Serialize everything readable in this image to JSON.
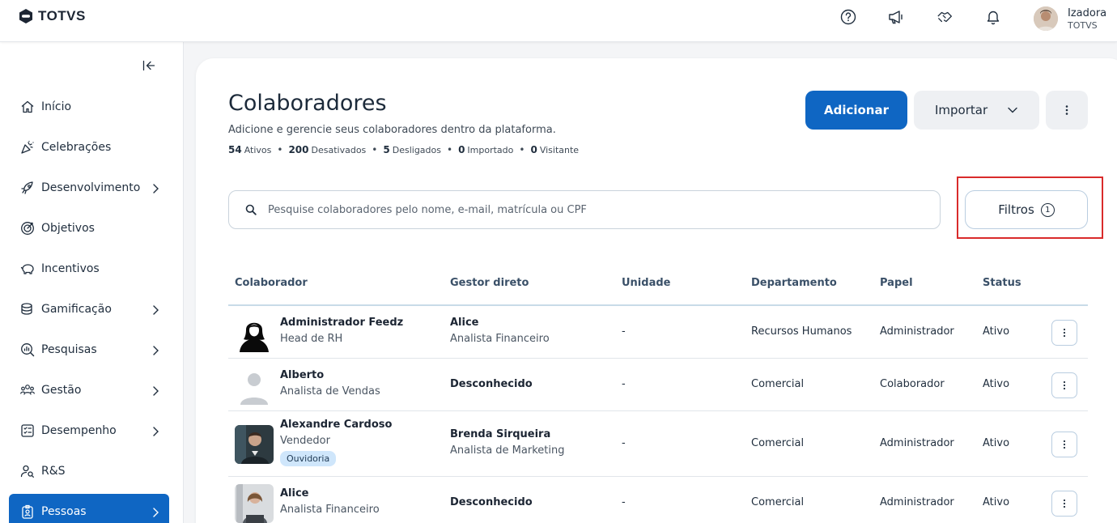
{
  "brand": {
    "name": "TOTVS"
  },
  "user": {
    "name": "Izadora",
    "org": "TOTVS"
  },
  "topbar_icons": [
    "help-icon",
    "megaphone-icon",
    "handshake-icon",
    "bell-icon"
  ],
  "sidebar": {
    "items": [
      {
        "label": "Início",
        "icon": "home-icon",
        "chevron": false,
        "active": false
      },
      {
        "label": "Celebrações",
        "icon": "party-icon",
        "chevron": false,
        "active": false
      },
      {
        "label": "Desenvolvimento",
        "icon": "rocket-icon",
        "chevron": true,
        "active": false
      },
      {
        "label": "Objetivos",
        "icon": "target-icon",
        "chevron": false,
        "active": false
      },
      {
        "label": "Incentivos",
        "icon": "piggy-bank-icon",
        "chevron": false,
        "active": false
      },
      {
        "label": "Gamificação",
        "icon": "coins-icon",
        "chevron": true,
        "active": false
      },
      {
        "label": "Pesquisas",
        "icon": "search-chart-icon",
        "chevron": true,
        "active": false
      },
      {
        "label": "Gestão",
        "icon": "team-icon",
        "chevron": true,
        "active": false
      },
      {
        "label": "Desempenho",
        "icon": "checklist-icon",
        "chevron": true,
        "active": false
      },
      {
        "label": "R&S",
        "icon": "user-search-icon",
        "chevron": false,
        "active": false
      },
      {
        "label": "Pessoas",
        "icon": "badge-icon",
        "chevron": true,
        "active": true
      }
    ]
  },
  "page": {
    "title": "Colaboradores",
    "subtitle": "Adicione e gerencie seus colaboradores dentro da plataforma.",
    "stats": [
      {
        "value": "54",
        "label": "Ativos"
      },
      {
        "value": "200",
        "label": "Desativados"
      },
      {
        "value": "5",
        "label": "Desligados"
      },
      {
        "value": "0",
        "label": "Importado"
      },
      {
        "value": "0",
        "label": "Visitante"
      }
    ],
    "add_label": "Adicionar",
    "import_label": "Importar",
    "search_placeholder": "Pesquise colaboradores pelo nome, e-mail, matrícula ou CPF",
    "filter_label": "Filtros",
    "filter_count": "1"
  },
  "table": {
    "headers": {
      "colaborador": "Colaborador",
      "gestor": "Gestor direto",
      "unidade": "Unidade",
      "departamento": "Departamento",
      "papel": "Papel",
      "status": "Status"
    },
    "rows": [
      {
        "name": "Administrador Feedz",
        "role": "Head de RH",
        "tag": "",
        "manager": "Alice",
        "manager_role": "Analista Financeiro",
        "unit": "-",
        "department": "Recursos Humanos",
        "paper": "Administrador",
        "status": "Ativo",
        "avatar": "silhouette-female"
      },
      {
        "name": "Alberto",
        "role": "Analista de Vendas",
        "tag": "",
        "manager": "Desconhecido",
        "manager_role": "",
        "unit": "-",
        "department": "Comercial",
        "paper": "Colaborador",
        "status": "Ativo",
        "avatar": "placeholder"
      },
      {
        "name": "Alexandre Cardoso",
        "role": "Vendedor",
        "tag": "Ouvidoria",
        "manager": "Brenda Sirqueira",
        "manager_role": "Analista de Marketing",
        "unit": "-",
        "department": "Comercial",
        "paper": "Administrador",
        "status": "Ativo",
        "avatar": "photo-male"
      },
      {
        "name": "Alice",
        "role": "Analista Financeiro",
        "tag": "",
        "manager": "Desconhecido",
        "manager_role": "",
        "unit": "-",
        "department": "Comercial",
        "paper": "Administrador",
        "status": "Ativo",
        "avatar": "photo-female"
      }
    ]
  },
  "colors": {
    "primary": "#0f66c3",
    "highlight": "#d92b2b",
    "tag_bg": "#cfe6fb"
  }
}
